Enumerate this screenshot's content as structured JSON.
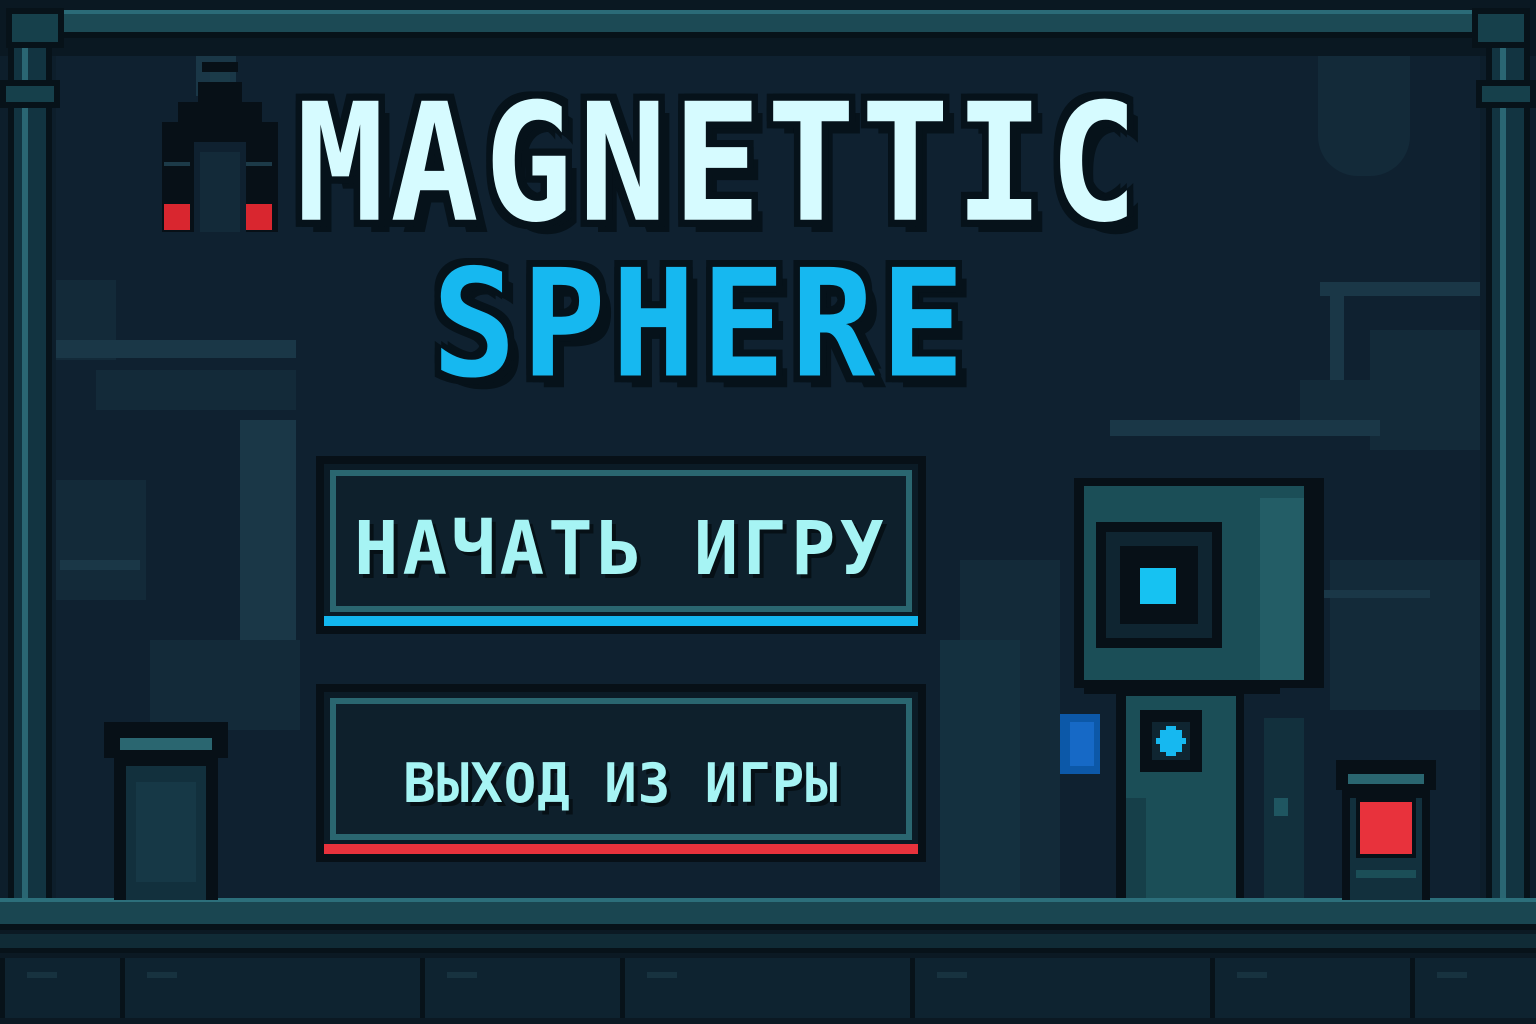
{
  "title": {
    "line1": "MAGNETTIC",
    "line2": "SPHERE"
  },
  "menu": {
    "start_label": "НАЧАТЬ ИГРУ",
    "exit_label": "ВЫХОД ИЗ ИГРЫ"
  },
  "icons": {
    "magnet": "magnet-icon",
    "robot": "robot-sprite",
    "canister": "canister-icon"
  },
  "colors": {
    "background": "#0d1e2b",
    "title_primary": "#d6fbff",
    "title_accent": "#16b8f0",
    "start_accent": "#12b6ef",
    "exit_accent": "#e8323c",
    "button_text": "#a6f4f4"
  }
}
